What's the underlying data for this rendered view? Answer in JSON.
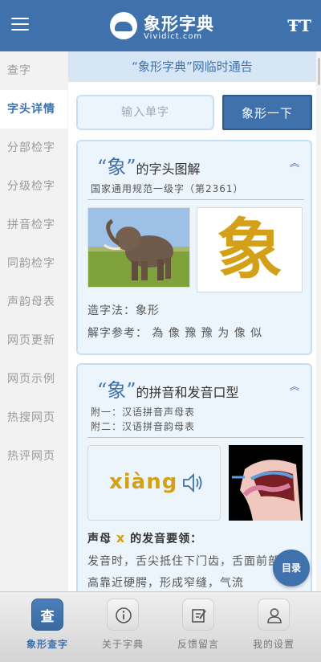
{
  "header": {
    "logo_title": "象形字典",
    "logo_subtitle": "Vividict.com",
    "font_icon": "T",
    "menu_icon": "hamburger-icon"
  },
  "sidebar": {
    "items": [
      {
        "label": "查字",
        "active": false
      },
      {
        "label": "字头详情",
        "active": true
      },
      {
        "label": "分部检字",
        "active": false
      },
      {
        "label": "分级检字",
        "active": false
      },
      {
        "label": "拼音检字",
        "active": false
      },
      {
        "label": "同韵检字",
        "active": false
      },
      {
        "label": "声韵母表",
        "active": false
      },
      {
        "label": "网页更新",
        "active": false
      },
      {
        "label": "网页示例",
        "active": false
      },
      {
        "label": "热搜网页",
        "active": false
      },
      {
        "label": "热评网页",
        "active": false
      }
    ]
  },
  "main": {
    "notice": "“象形字典”网临时通告",
    "search": {
      "placeholder": "输入单字",
      "button_label": "象形一下"
    },
    "card1": {
      "title_char": "“象”",
      "title_rest": "的字头图解",
      "subtitle": "国家通用规范一级字（第2361）",
      "glyph": "象",
      "method": "造字法：象形",
      "reference": "解字参考：   為 像 豫 豫 为 像 似"
    },
    "card2": {
      "title_char": "“象”",
      "title_rest": "的拼音和发音口型",
      "appendix1": "附一：汉语拼音声母表",
      "appendix2": "附二：汉语拼音韵母表",
      "pinyin": "xiàng",
      "tip_prefix": "声母",
      "tip_letter": "x",
      "tip_suffix": "的发音要领：",
      "tip_text": "发音时，舌尖抵住下门齿，舌面前部抬高靠近硬腭，形成窄缝，气流"
    }
  },
  "toc_button": "目录",
  "tabbar": {
    "tabs": [
      {
        "label": "象形查字",
        "icon": "search-char-icon",
        "char": "查",
        "active": true
      },
      {
        "label": "关于字典",
        "icon": "info-icon",
        "active": false
      },
      {
        "label": "反馈留言",
        "icon": "edit-icon",
        "active": false
      },
      {
        "label": "我的设置",
        "icon": "user-icon",
        "active": false
      }
    ]
  },
  "colors": {
    "primary": "#3f72ad",
    "accent": "#d4a017",
    "card_bg": "#edf5fc",
    "card_border": "#c7def2"
  }
}
